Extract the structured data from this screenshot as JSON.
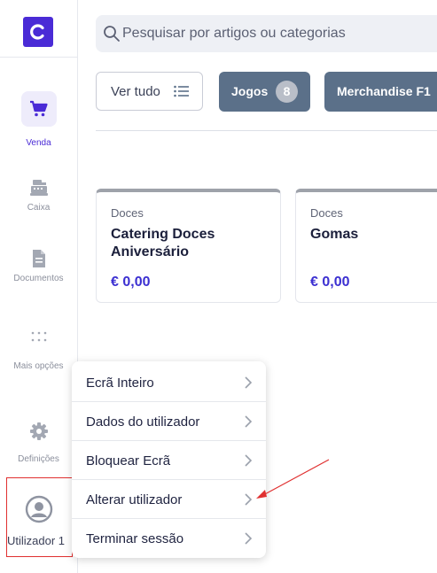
{
  "sidebar": {
    "logo_icon": "c-logo-icon",
    "items": [
      {
        "label": "Venda",
        "icon": "cart-icon",
        "active": true
      },
      {
        "label": "Caixa",
        "icon": "cash-register-icon"
      },
      {
        "label": "Documentos",
        "icon": "document-icon"
      },
      {
        "label": "Mais opções",
        "icon": "dots-grid-icon"
      },
      {
        "label": "Definições",
        "icon": "gear-icon"
      }
    ],
    "user": {
      "label": "Utilizador 1",
      "icon": "user-avatar-icon"
    }
  },
  "search": {
    "placeholder": "Pesquisar por artigos ou categorias"
  },
  "filters": {
    "view_all": "Ver tudo",
    "chips": [
      {
        "label": "Jogos",
        "count": "8"
      },
      {
        "label": "Merchandise F1"
      }
    ]
  },
  "products": [
    {
      "category": "Doces",
      "name": "Catering Doces Aniversário",
      "price": "€ 0,00"
    },
    {
      "category": "Doces",
      "name": "Gomas",
      "price": "€ 0,00"
    }
  ],
  "user_menu": {
    "items": [
      {
        "label": "Ecrã Inteiro"
      },
      {
        "label": "Dados do utilizador"
      },
      {
        "label": "Bloquear Ecrã"
      },
      {
        "label": "Alterar utilizador"
      },
      {
        "label": "Terminar sessão"
      }
    ]
  },
  "colors": {
    "brand": "#4a2bd6",
    "chip": "#5b7089",
    "price": "#3b2fd1",
    "annotation": "#e03030"
  }
}
